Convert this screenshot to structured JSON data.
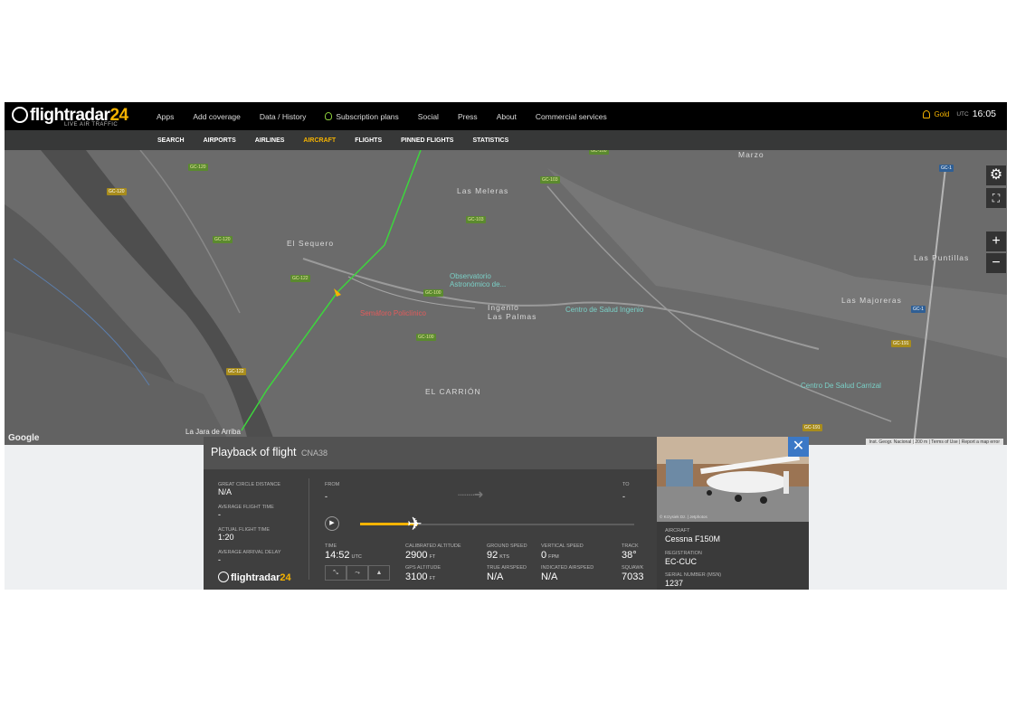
{
  "brand": {
    "name_part1": "flightradar",
    "name_part2": "24",
    "tagline": "LIVE AIR TRAFFIC"
  },
  "main_nav": [
    "Apps",
    "Add coverage",
    "Data / History",
    "Subscription plans",
    "Social",
    "Press",
    "About",
    "Commercial services"
  ],
  "account": {
    "tier": "Gold",
    "utc_label": "UTC",
    "time": "16:05"
  },
  "sub_nav": {
    "items": [
      "SEARCH",
      "AIRPORTS",
      "AIRLINES",
      "AIRCRAFT",
      "FLIGHTS",
      "PINNED FLIGHTS",
      "STATISTICS"
    ],
    "active": "AIRCRAFT"
  },
  "map": {
    "places": [
      "Las Meleras",
      "El Sequero",
      "Las Puntillas",
      "Las Majoreras",
      "EL CARRIÓN",
      "Marzo",
      "Ingenio",
      "Las Palmas"
    ],
    "pois": [
      "Observatorio Astronómico de...",
      "Semáforo Policlínico",
      "Centro de Salud Ingenio",
      "Centro De Salud Carrizal",
      "La Jara de Arriba"
    ],
    "roads": [
      "GC-120",
      "GC-100",
      "GC-122",
      "GC-103",
      "GC-191",
      "GC-1"
    ],
    "attribution": [
      "Inst. Geogr. Nacional",
      "200 m",
      "Terms of Use",
      "Report a map error"
    ],
    "google": "Google"
  },
  "controls": {
    "settings_icon": "gear-icon",
    "fullscreen_icon": "expand-icon",
    "zoom_in": "+",
    "zoom_out": "−"
  },
  "playback": {
    "title": "Playback of flight",
    "callsign": "CNA38",
    "stats": [
      {
        "label": "GREAT CIRCLE DISTANCE",
        "value": "N/A"
      },
      {
        "label": "AVERAGE FLIGHT TIME",
        "value": "-"
      },
      {
        "label": "ACTUAL FLIGHT TIME",
        "value": "1:20"
      },
      {
        "label": "AVERAGE ARRIVAL DELAY",
        "value": "-"
      }
    ],
    "from_label": "FROM",
    "from_value": "-",
    "to_label": "TO",
    "to_value": "-",
    "progress": 0.21,
    "metrics": {
      "time": {
        "label": "TIME",
        "value": "14:52",
        "unit": "UTC"
      },
      "cal_alt": {
        "label": "CALIBRATED ALTITUDE",
        "value": "2900",
        "unit": "FT"
      },
      "ground_speed": {
        "label": "GROUND SPEED",
        "value": "92",
        "unit": "KTS"
      },
      "vertical_speed": {
        "label": "VERTICAL SPEED",
        "value": "0",
        "unit": "FPM"
      },
      "track": {
        "label": "TRACK",
        "value": "38°"
      },
      "gps_alt": {
        "label": "GPS ALTITUDE",
        "value": "3100",
        "unit": "FT"
      },
      "tas": {
        "label": "TRUE AIRSPEED",
        "value": "N/A"
      },
      "ias": {
        "label": "INDICATED AIRSPEED",
        "value": "N/A"
      },
      "squawk": {
        "label": "SQUAWK",
        "value": "7033"
      }
    },
    "footer_logo_part1": "flightradar",
    "footer_logo_part2": "24"
  },
  "aircraft": {
    "photo_credit": "© Krzysiek Dz. | Jetphotos",
    "type_label": "AIRCRAFT",
    "type_value": "Cessna F150M",
    "reg_label": "REGISTRATION",
    "reg_value": "EC-CUC",
    "msn_label": "SERIAL NUMBER (MSN)",
    "msn_value": "1237"
  }
}
